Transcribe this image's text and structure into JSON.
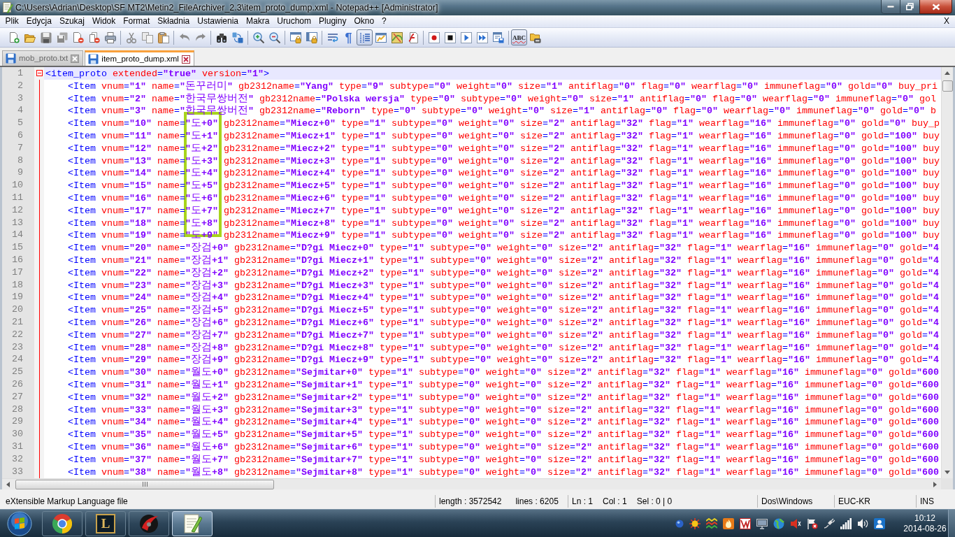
{
  "window": {
    "title": "C:\\Users\\Adrian\\Desktop\\SF MT2\\Metin2_FileArchiver_2.3\\item_proto_dump.xml - Notepad++ [Administrator]"
  },
  "menu": {
    "items": [
      "Plik",
      "Edycja",
      "Szukaj",
      "Widok",
      "Format",
      "Składnia",
      "Ustawienia",
      "Makra",
      "Uruchom",
      "Pluginy",
      "Okno",
      "?"
    ],
    "close_label": "X"
  },
  "toolbar": {
    "groups": [
      [
        {
          "kind": "icon",
          "pressed": false
        },
        {
          "kind": "icon",
          "pressed": false
        },
        {
          "kind": "icon",
          "pressed": false
        },
        {
          "kind": "icon",
          "pressed": false
        },
        {
          "kind": "icon",
          "pressed": false
        },
        {
          "kind": "icon",
          "pressed": false
        },
        {
          "kind": "icon",
          "pressed": false
        }
      ],
      [
        {
          "kind": "icon",
          "pressed": false
        },
        {
          "kind": "icon",
          "pressed": false
        },
        {
          "kind": "icon",
          "pressed": false
        }
      ],
      [
        {
          "kind": "icon",
          "pressed": false
        },
        {
          "kind": "icon",
          "pressed": false
        }
      ],
      [
        {
          "kind": "icon",
          "pressed": false
        },
        {
          "kind": "icon",
          "pressed": false
        }
      ],
      [
        {
          "kind": "icon",
          "pressed": false
        },
        {
          "kind": "icon",
          "pressed": false
        }
      ],
      [
        {
          "kind": "icon",
          "pressed": false
        },
        {
          "kind": "icon",
          "pressed": false
        }
      ],
      [
        {
          "kind": "icon",
          "pressed": false
        },
        {
          "kind": "glyph",
          "label": "¶",
          "pressed": false
        },
        {
          "kind": "icon",
          "pressed": true
        },
        {
          "kind": "icon",
          "pressed": false
        },
        {
          "kind": "icon",
          "pressed": false
        },
        {
          "kind": "icon",
          "pressed": false
        }
      ],
      [
        {
          "kind": "icon",
          "pressed": false
        },
        {
          "kind": "icon",
          "pressed": false
        },
        {
          "kind": "icon",
          "pressed": false
        },
        {
          "kind": "icon",
          "pressed": false
        },
        {
          "kind": "icon",
          "pressed": false
        }
      ],
      [
        {
          "kind": "spelling",
          "label": "ABC",
          "pressed": true
        },
        {
          "kind": "icon",
          "pressed": false
        }
      ]
    ]
  },
  "tabs": [
    {
      "label": "mob_proto.txt",
      "selected": false
    },
    {
      "label": "item_proto_dump.xml",
      "selected": true
    }
  ],
  "editor": {
    "fold": {
      "expanded": true
    },
    "lines": [
      {
        "number": "1",
        "current": true,
        "text": "<item_proto extended=\"true\" version=\"1\">"
      },
      {
        "number": "2",
        "current": false,
        "text": "    <Item vnum=\"1\" name=\"돈꾸러미\" gb2312name=\"Yang\" type=\"9\" subtype=\"0\" weight=\"0\" size=\"1\" antiflag=\"0\" flag=\"0\" wearflag=\"0\" immuneflag=\"0\" gold=\"0\" buy_pri"
      },
      {
        "number": "3",
        "current": false,
        "text": "    <Item vnum=\"2\" name=\"한국무쌍버전\" gb2312name=\"Polska wersja\" type=\"0\" subtype=\"0\" weight=\"0\" size=\"1\" antiflag=\"0\" flag=\"0\" wearflag=\"0\" immuneflag=\"0\" gol"
      },
      {
        "number": "4",
        "current": false,
        "text": "    <Item vnum=\"3\" name=\"한국무쌍버전\" gb2312name=\"Reborn\" type=\"0\" subtype=\"0\" weight=\"0\" size=\"1\" antiflag=\"0\" flag=\"0\" wearflag=\"0\" immuneflag=\"0\" gold=\"0\" b"
      },
      {
        "number": "5",
        "current": false,
        "text": "    <Item vnum=\"10\" name=\"도+0\" gb2312name=\"Miecz+0\" type=\"1\" subtype=\"0\" weight=\"0\" size=\"2\" antiflag=\"32\" flag=\"1\" wearflag=\"16\" immuneflag=\"0\" gold=\"0\" buy_p"
      },
      {
        "number": "6",
        "current": false,
        "text": "    <Item vnum=\"11\" name=\"도+1\" gb2312name=\"Miecz+1\" type=\"1\" subtype=\"0\" weight=\"0\" size=\"2\" antiflag=\"32\" flag=\"1\" wearflag=\"16\" immuneflag=\"0\" gold=\"100\" buy"
      },
      {
        "number": "7",
        "current": false,
        "text": "    <Item vnum=\"12\" name=\"도+2\" gb2312name=\"Miecz+2\" type=\"1\" subtype=\"0\" weight=\"0\" size=\"2\" antiflag=\"32\" flag=\"1\" wearflag=\"16\" immuneflag=\"0\" gold=\"100\" buy"
      },
      {
        "number": "8",
        "current": false,
        "text": "    <Item vnum=\"13\" name=\"도+3\" gb2312name=\"Miecz+3\" type=\"1\" subtype=\"0\" weight=\"0\" size=\"2\" antiflag=\"32\" flag=\"1\" wearflag=\"16\" immuneflag=\"0\" gold=\"100\" buy"
      },
      {
        "number": "9",
        "current": false,
        "text": "    <Item vnum=\"14\" name=\"도+4\" gb2312name=\"Miecz+4\" type=\"1\" subtype=\"0\" weight=\"0\" size=\"2\" antiflag=\"32\" flag=\"1\" wearflag=\"16\" immuneflag=\"0\" gold=\"100\" buy"
      },
      {
        "number": "10",
        "current": false,
        "text": "    <Item vnum=\"15\" name=\"도+5\" gb2312name=\"Miecz+5\" type=\"1\" subtype=\"0\" weight=\"0\" size=\"2\" antiflag=\"32\" flag=\"1\" wearflag=\"16\" immuneflag=\"0\" gold=\"100\" buy"
      },
      {
        "number": "11",
        "current": false,
        "text": "    <Item vnum=\"16\" name=\"도+6\" gb2312name=\"Miecz+6\" type=\"1\" subtype=\"0\" weight=\"0\" size=\"2\" antiflag=\"32\" flag=\"1\" wearflag=\"16\" immuneflag=\"0\" gold=\"100\" buy"
      },
      {
        "number": "12",
        "current": false,
        "text": "    <Item vnum=\"17\" name=\"도+7\" gb2312name=\"Miecz+7\" type=\"1\" subtype=\"0\" weight=\"0\" size=\"2\" antiflag=\"32\" flag=\"1\" wearflag=\"16\" immuneflag=\"0\" gold=\"100\" buy"
      },
      {
        "number": "13",
        "current": false,
        "text": "    <Item vnum=\"18\" name=\"도+8\" gb2312name=\"Miecz+8\" type=\"1\" subtype=\"0\" weight=\"0\" size=\"2\" antiflag=\"32\" flag=\"1\" wearflag=\"16\" immuneflag=\"0\" gold=\"100\" buy"
      },
      {
        "number": "14",
        "current": false,
        "text": "    <Item vnum=\"19\" name=\"도+9\" gb2312name=\"Miecz+9\" type=\"1\" subtype=\"0\" weight=\"0\" size=\"2\" antiflag=\"32\" flag=\"1\" wearflag=\"16\" immuneflag=\"0\" gold=\"100\" buy"
      },
      {
        "number": "15",
        "current": false,
        "text": "    <Item vnum=\"20\" name=\"장검+0\" gb2312name=\"D?gi Miecz+0\" type=\"1\" subtype=\"0\" weight=\"0\" size=\"2\" antiflag=\"32\" flag=\"1\" wearflag=\"16\" immuneflag=\"0\" gold=\"4"
      },
      {
        "number": "16",
        "current": false,
        "text": "    <Item vnum=\"21\" name=\"장검+1\" gb2312name=\"D?gi Miecz+1\" type=\"1\" subtype=\"0\" weight=\"0\" size=\"2\" antiflag=\"32\" flag=\"1\" wearflag=\"16\" immuneflag=\"0\" gold=\"4"
      },
      {
        "number": "17",
        "current": false,
        "text": "    <Item vnum=\"22\" name=\"장검+2\" gb2312name=\"D?gi Miecz+2\" type=\"1\" subtype=\"0\" weight=\"0\" size=\"2\" antiflag=\"32\" flag=\"1\" wearflag=\"16\" immuneflag=\"0\" gold=\"4"
      },
      {
        "number": "18",
        "current": false,
        "text": "    <Item vnum=\"23\" name=\"장검+3\" gb2312name=\"D?gi Miecz+3\" type=\"1\" subtype=\"0\" weight=\"0\" size=\"2\" antiflag=\"32\" flag=\"1\" wearflag=\"16\" immuneflag=\"0\" gold=\"4"
      },
      {
        "number": "19",
        "current": false,
        "text": "    <Item vnum=\"24\" name=\"장검+4\" gb2312name=\"D?gi Miecz+4\" type=\"1\" subtype=\"0\" weight=\"0\" size=\"2\" antiflag=\"32\" flag=\"1\" wearflag=\"16\" immuneflag=\"0\" gold=\"4"
      },
      {
        "number": "20",
        "current": false,
        "text": "    <Item vnum=\"25\" name=\"장검+5\" gb2312name=\"D?gi Miecz+5\" type=\"1\" subtype=\"0\" weight=\"0\" size=\"2\" antiflag=\"32\" flag=\"1\" wearflag=\"16\" immuneflag=\"0\" gold=\"4"
      },
      {
        "number": "21",
        "current": false,
        "text": "    <Item vnum=\"26\" name=\"장검+6\" gb2312name=\"D?gi Miecz+6\" type=\"1\" subtype=\"0\" weight=\"0\" size=\"2\" antiflag=\"32\" flag=\"1\" wearflag=\"16\" immuneflag=\"0\" gold=\"4"
      },
      {
        "number": "22",
        "current": false,
        "text": "    <Item vnum=\"27\" name=\"장검+7\" gb2312name=\"D?gi Miecz+7\" type=\"1\" subtype=\"0\" weight=\"0\" size=\"2\" antiflag=\"32\" flag=\"1\" wearflag=\"16\" immuneflag=\"0\" gold=\"4"
      },
      {
        "number": "23",
        "current": false,
        "text": "    <Item vnum=\"28\" name=\"장검+8\" gb2312name=\"D?gi Miecz+8\" type=\"1\" subtype=\"0\" weight=\"0\" size=\"2\" antiflag=\"32\" flag=\"1\" wearflag=\"16\" immuneflag=\"0\" gold=\"4"
      },
      {
        "number": "24",
        "current": false,
        "text": "    <Item vnum=\"29\" name=\"장검+9\" gb2312name=\"D?gi Miecz+9\" type=\"1\" subtype=\"0\" weight=\"0\" size=\"2\" antiflag=\"32\" flag=\"1\" wearflag=\"16\" immuneflag=\"0\" gold=\"4"
      },
      {
        "number": "25",
        "current": false,
        "text": "    <Item vnum=\"30\" name=\"월도+0\" gb2312name=\"Sejmitar+0\" type=\"1\" subtype=\"0\" weight=\"0\" size=\"2\" antiflag=\"32\" flag=\"1\" wearflag=\"16\" immuneflag=\"0\" gold=\"600"
      },
      {
        "number": "26",
        "current": false,
        "text": "    <Item vnum=\"31\" name=\"월도+1\" gb2312name=\"Sejmitar+1\" type=\"1\" subtype=\"0\" weight=\"0\" size=\"2\" antiflag=\"32\" flag=\"1\" wearflag=\"16\" immuneflag=\"0\" gold=\"600"
      },
      {
        "number": "27",
        "current": false,
        "text": "    <Item vnum=\"32\" name=\"월도+2\" gb2312name=\"Sejmitar+2\" type=\"1\" subtype=\"0\" weight=\"0\" size=\"2\" antiflag=\"32\" flag=\"1\" wearflag=\"16\" immuneflag=\"0\" gold=\"600"
      },
      {
        "number": "28",
        "current": false,
        "text": "    <Item vnum=\"33\" name=\"월도+3\" gb2312name=\"Sejmitar+3\" type=\"1\" subtype=\"0\" weight=\"0\" size=\"2\" antiflag=\"32\" flag=\"1\" wearflag=\"16\" immuneflag=\"0\" gold=\"600"
      },
      {
        "number": "29",
        "current": false,
        "text": "    <Item vnum=\"34\" name=\"월도+4\" gb2312name=\"Sejmitar+4\" type=\"1\" subtype=\"0\" weight=\"0\" size=\"2\" antiflag=\"32\" flag=\"1\" wearflag=\"16\" immuneflag=\"0\" gold=\"600"
      },
      {
        "number": "30",
        "current": false,
        "text": "    <Item vnum=\"35\" name=\"월도+5\" gb2312name=\"Sejmitar+5\" type=\"1\" subtype=\"0\" weight=\"0\" size=\"2\" antiflag=\"32\" flag=\"1\" wearflag=\"16\" immuneflag=\"0\" gold=\"600"
      },
      {
        "number": "31",
        "current": false,
        "text": "    <Item vnum=\"36\" name=\"월도+6\" gb2312name=\"Sejmitar+6\" type=\"1\" subtype=\"0\" weight=\"0\" size=\"2\" antiflag=\"32\" flag=\"1\" wearflag=\"16\" immuneflag=\"0\" gold=\"600"
      },
      {
        "number": "32",
        "current": false,
        "text": "    <Item vnum=\"37\" name=\"월도+7\" gb2312name=\"Sejmitar+7\" type=\"1\" subtype=\"0\" weight=\"0\" size=\"2\" antiflag=\"32\" flag=\"1\" wearflag=\"16\" immuneflag=\"0\" gold=\"600"
      },
      {
        "number": "33",
        "current": false,
        "text": "    <Item vnum=\"38\" name=\"월도+8\" gb2312name=\"Sejmitar+8\" type=\"1\" subtype=\"0\" weight=\"0\" size=\"2\" antiflag=\"32\" flag=\"1\" wearflag=\"16\" immuneflag=\"0\" gold=\"600"
      }
    ]
  },
  "status_bar": {
    "sections": [
      [
        "eXtensible Markup Language file"
      ],
      [
        "length : 3572542",
        "lines : 6205"
      ],
      [
        "Ln : 1",
        "Col : 1",
        "Sel : 0 | 0"
      ],
      [
        "Dos\\Windows"
      ],
      [
        "EUC-KR"
      ],
      [
        "INS"
      ]
    ]
  },
  "taskbar": {
    "apps": [
      {
        "kind": "browser",
        "active": false
      },
      {
        "kind": "letter_tile",
        "label": "L",
        "active": false
      },
      {
        "kind": "disc",
        "active": false
      },
      {
        "kind": "editor",
        "active": true
      }
    ],
    "clock": {
      "time": "10:12",
      "date": "2014-08-26"
    }
  }
}
